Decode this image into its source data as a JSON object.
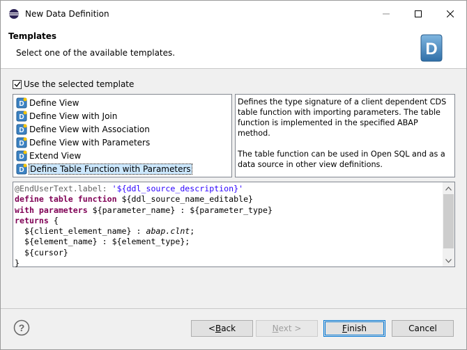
{
  "window": {
    "title": "New Data Definition"
  },
  "banner": {
    "title": "Templates",
    "subtitle": "Select one of the available templates."
  },
  "use_template": {
    "label": "Use the selected template",
    "checked": true
  },
  "templates": [
    {
      "label": "Define View",
      "selected": false
    },
    {
      "label": "Define View with Join",
      "selected": false
    },
    {
      "label": "Define View with Association",
      "selected": false
    },
    {
      "label": "Define View with Parameters",
      "selected": false
    },
    {
      "label": "Extend View",
      "selected": false
    },
    {
      "label": "Define Table Function with Parameters",
      "selected": true
    }
  ],
  "description": {
    "p1": "Defines the type signature of a client dependent CDS table function with importing parameters. The table function is implemented in the specified ABAP method.",
    "p2": "The table function can be used in Open SQL and as a data source in other view definitions."
  },
  "code": {
    "l1_annotation": "@EndUserText.label:",
    "l1_string": "'${ddl_source_description}'",
    "l2_keyword": "define table function",
    "l2_rest": " ${ddl_source_name_editable}",
    "l3_keyword": "with parameters",
    "l3_rest": " ${parameter_name} : ${parameter_type}",
    "l4_keyword": "returns",
    "l4_rest": " {",
    "l5_name": "  ${client_element_name} : ",
    "l5_type": "abap.clnt",
    "l5_end": ";",
    "l6": "  ${element_name} : ${element_type};",
    "l7": "  ${cursor}",
    "l8": "}"
  },
  "buttons": {
    "back_pre": "< ",
    "back_mnemonic": "B",
    "back_post": "ack",
    "next_mnemonic": "N",
    "next_post": "ext >",
    "finish_mnemonic": "F",
    "finish_post": "inish",
    "cancel": "Cancel"
  },
  "colors": {
    "keyword": "#7f0055",
    "string": "#2a00ff",
    "annotation": "#646464",
    "selection": "#cce8ff",
    "default_button_border": "#0078d7"
  }
}
